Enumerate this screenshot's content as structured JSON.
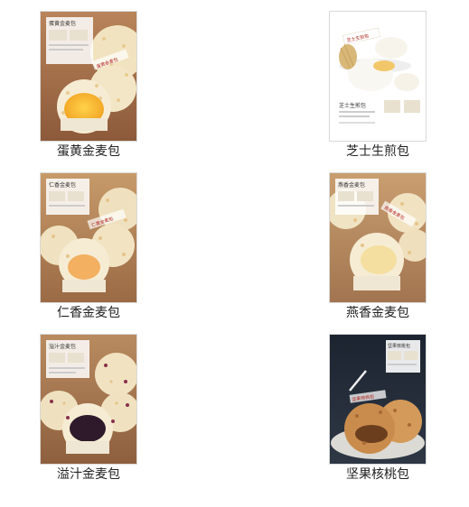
{
  "products": [
    {
      "name": "蛋黄金麦包",
      "title": "蛋黄金麦包",
      "stamp": "蛋黄金麦包"
    },
    {
      "name": "芝士生煎包",
      "title": "芝士生煎包",
      "stamp": "芝士生煎包"
    },
    {
      "name": "仁香金麦包",
      "title": "仁香金麦包",
      "stamp": "仁香金麦包"
    },
    {
      "name": "燕香金麦包",
      "title": "燕香金麦包",
      "stamp": "燕香金麦包"
    },
    {
      "name": "溢汁金麦包",
      "title": "溢汁金麦包",
      "stamp": ""
    },
    {
      "name": "坚果核桃包",
      "title": "坚果核桃包",
      "stamp": "坚果核桃包"
    }
  ]
}
